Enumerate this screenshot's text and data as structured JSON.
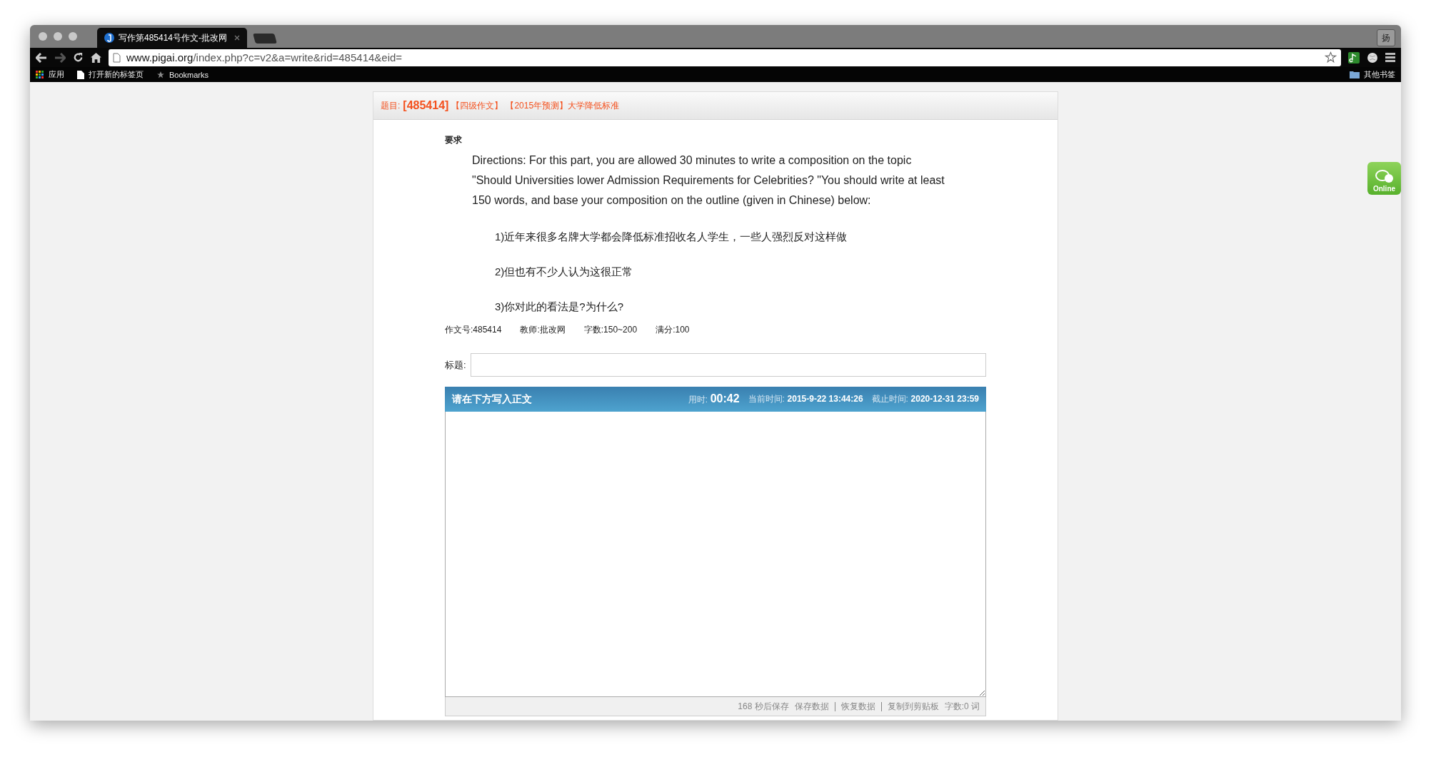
{
  "browser": {
    "tab_title": "写作第485414号作文-批改网",
    "ime_button": "扬",
    "url": {
      "host": "www.pigai.org",
      "path": "/index.php?c=v2&a=write&rid=485414&eid="
    },
    "bookmarks": [
      {
        "kind": "apps",
        "label": "应用"
      },
      {
        "kind": "page",
        "label": "打开新的标签页"
      },
      {
        "kind": "star",
        "label": "Bookmarks"
      }
    ],
    "other_bookmarks": "其他书签"
  },
  "header": {
    "label": "题目:",
    "id": "[485414]",
    "tags": [
      "【四级作文】",
      "【2015年预测】大学降低标准"
    ]
  },
  "requirement": {
    "label": "要求",
    "directions": "Directions: For this part, you are allowed 30 minutes to write a composition on the topic \"Should Universities lower Admission Requirements for Celebrities? \"You should write at least 150 words, and base your composition on the outline (given in Chinese) below:",
    "outline": [
      "1)近年来很多名牌大学都会降低标准招收名人学生，一些人强烈反对这样做",
      "2)但也有不少人认为这很正常",
      "3)你对此的看法是?为什么?"
    ]
  },
  "info": [
    "作文号:485414",
    "教师:批改网",
    "字数:150~200",
    "满分:100"
  ],
  "title_field": {
    "label": "标题:"
  },
  "editor": {
    "heading": "请在下方写入正文",
    "elapsed_label": "用时:",
    "elapsed": "00:42",
    "now_label": "当前时间:",
    "now": "2015-9-22 13:44:26",
    "deadline_label": "截止时间:",
    "deadline": "2020-12-31 23:59"
  },
  "footer": {
    "autosave": "168 秒后保存",
    "actions": [
      "保存数据",
      "恢复数据",
      "复制到剪贴板"
    ],
    "word_count": "字数:0 词"
  },
  "online_badge": "Online"
}
